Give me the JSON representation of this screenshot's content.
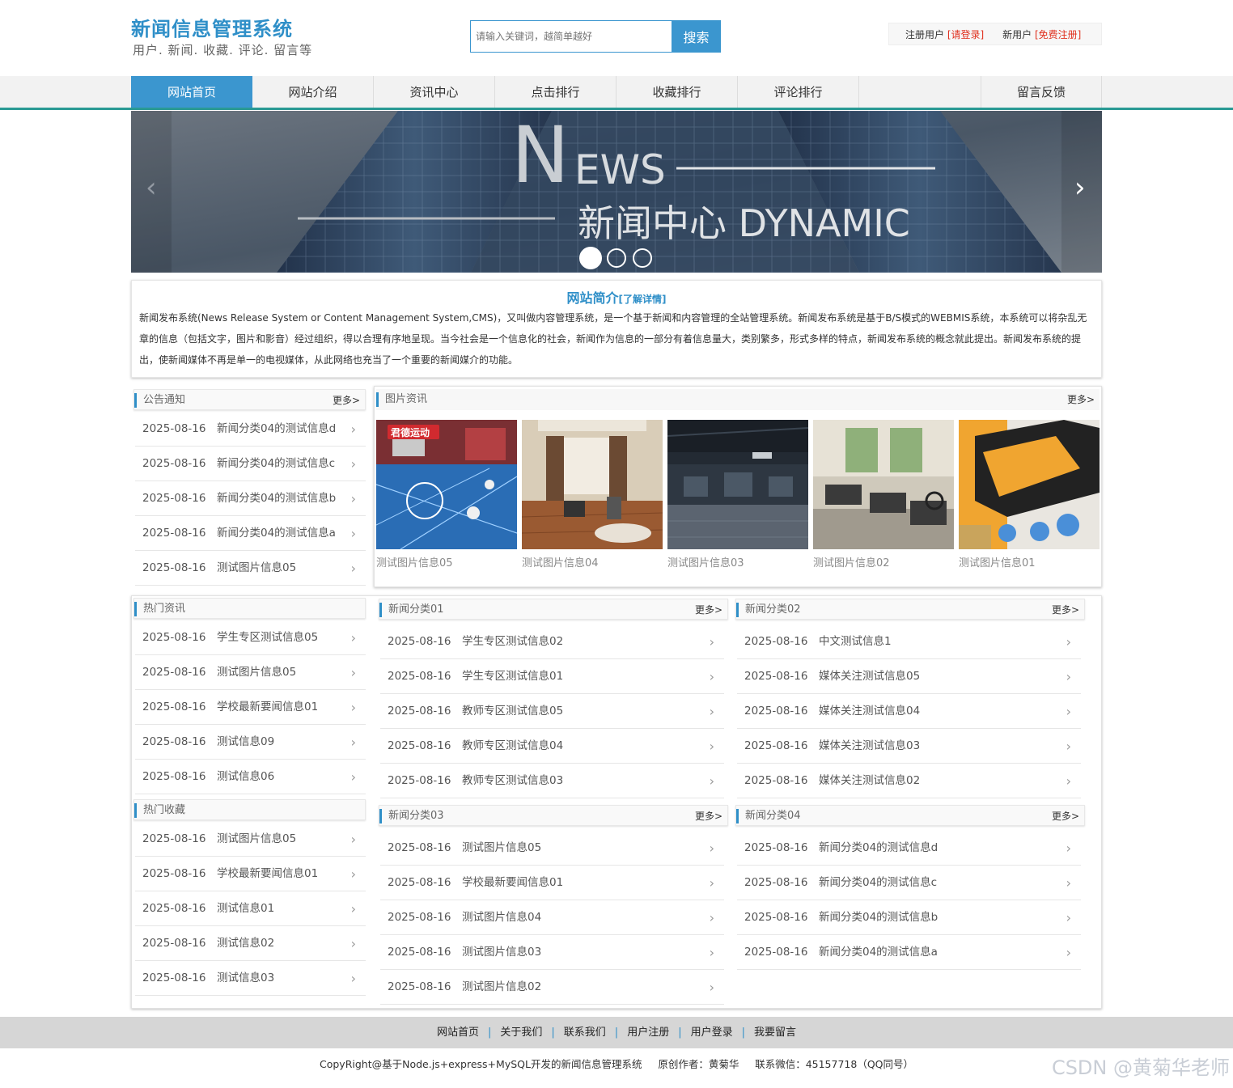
{
  "header": {
    "title": "新闻信息管理系统",
    "subtitle": "用户. 新闻. 收藏. 评论. 留言等",
    "search_placeholder": "请输入关键词，越简单越好",
    "search_button": "搜索",
    "user_label1": "注册用户",
    "login_link": "[请登录]",
    "user_label2": "新用户",
    "register_link": "[免费注册]"
  },
  "nav": [
    "网站首页",
    "网站介绍",
    "资讯中心",
    "点击排行",
    "收藏排行",
    "评论排行",
    "留言反馈"
  ],
  "banner": {
    "big_letter": "N",
    "ews": "EWS",
    "line2": "新闻中心  DYNAMIC",
    "prev": "‹",
    "next": "›"
  },
  "intro": {
    "title": "网站简介",
    "more": "[了解详情]",
    "text": "新闻发布系统(News Release System or Content Management System,CMS)，又叫做内容管理系统，是一个基于新闻和内容管理的全站管理系统。新闻发布系统是基于B/S模式的WEBMIS系统，本系统可以将杂乱无章的信息（包括文字，图片和影音）经过组织，得以合理有序地呈现。当今社会是一个信息化的社会，新闻作为信息的一部分有着信息量大，类别繁多，形式多样的特点，新闻发布系统的概念就此提出。新闻发布系统的提出，使新闻媒体不再是单一的电视媒体，从此网络也充当了一个重要的新闻媒介的功能。"
  },
  "more_label": "更多>",
  "arrow": "›",
  "notice": {
    "title": "公告通知",
    "items": [
      {
        "date": "2025-08-16",
        "title": "新闻分类04的测试信息d"
      },
      {
        "date": "2025-08-16",
        "title": "新闻分类04的测试信息c"
      },
      {
        "date": "2025-08-16",
        "title": "新闻分类04的测试信息b"
      },
      {
        "date": "2025-08-16",
        "title": "新闻分类04的测试信息a"
      },
      {
        "date": "2025-08-16",
        "title": "测试图片信息05"
      }
    ]
  },
  "pictures": {
    "title": "图片资讯",
    "items": [
      {
        "caption": "测试图片信息05",
        "logo": "君德运动"
      },
      {
        "caption": "测试图片信息04"
      },
      {
        "caption": "测试图片信息03"
      },
      {
        "caption": "测试图片信息02"
      },
      {
        "caption": "测试图片信息01"
      }
    ]
  },
  "hot_news": {
    "title": "热门资讯",
    "items": [
      {
        "date": "2025-08-16",
        "title": "学生专区测试信息05"
      },
      {
        "date": "2025-08-16",
        "title": "测试图片信息05"
      },
      {
        "date": "2025-08-16",
        "title": "学校最新要闻信息01"
      },
      {
        "date": "2025-08-16",
        "title": "测试信息09"
      },
      {
        "date": "2025-08-16",
        "title": "测试信息06"
      }
    ]
  },
  "hot_fav": {
    "title": "热门收藏",
    "items": [
      {
        "date": "2025-08-16",
        "title": "测试图片信息05"
      },
      {
        "date": "2025-08-16",
        "title": "学校最新要闻信息01"
      },
      {
        "date": "2025-08-16",
        "title": "测试信息01"
      },
      {
        "date": "2025-08-16",
        "title": "测试信息02"
      },
      {
        "date": "2025-08-16",
        "title": "测试信息03"
      }
    ]
  },
  "cat01": {
    "title": "新闻分类01",
    "items": [
      {
        "date": "2025-08-16",
        "title": "学生专区测试信息02"
      },
      {
        "date": "2025-08-16",
        "title": "学生专区测试信息01"
      },
      {
        "date": "2025-08-16",
        "title": "教师专区测试信息05"
      },
      {
        "date": "2025-08-16",
        "title": "教师专区测试信息04"
      },
      {
        "date": "2025-08-16",
        "title": "教师专区测试信息03"
      }
    ]
  },
  "cat02": {
    "title": "新闻分类02",
    "items": [
      {
        "date": "2025-08-16",
        "title": "中文测试信息1"
      },
      {
        "date": "2025-08-16",
        "title": "媒体关注测试信息05"
      },
      {
        "date": "2025-08-16",
        "title": "媒体关注测试信息04"
      },
      {
        "date": "2025-08-16",
        "title": "媒体关注测试信息03"
      },
      {
        "date": "2025-08-16",
        "title": "媒体关注测试信息02"
      }
    ]
  },
  "cat03": {
    "title": "新闻分类03",
    "items": [
      {
        "date": "2025-08-16",
        "title": "测试图片信息05"
      },
      {
        "date": "2025-08-16",
        "title": "学校最新要闻信息01"
      },
      {
        "date": "2025-08-16",
        "title": "测试图片信息04"
      },
      {
        "date": "2025-08-16",
        "title": "测试图片信息03"
      },
      {
        "date": "2025-08-16",
        "title": "测试图片信息02"
      }
    ]
  },
  "cat04": {
    "title": "新闻分类04",
    "items": [
      {
        "date": "2025-08-16",
        "title": "新闻分类04的测试信息d"
      },
      {
        "date": "2025-08-16",
        "title": "新闻分类04的测试信息c"
      },
      {
        "date": "2025-08-16",
        "title": "新闻分类04的测试信息b"
      },
      {
        "date": "2025-08-16",
        "title": "新闻分类04的测试信息a"
      }
    ]
  },
  "footer": {
    "links": [
      "网站首页",
      "关于我们",
      "联系我们",
      "用户注册",
      "用户登录",
      "我要留言"
    ],
    "copyright": "CopyRight@基于Node.js+express+MySQL开发的新闻信息管理系统     原创作者：黄菊华     联系微信：45157718（QQ同号）",
    "watermark": "CSDN @黄菊华老师"
  },
  "colors": {
    "accent": "#3b96cf",
    "nav_underline": "#2a9a94",
    "link_red": "#e0301e"
  }
}
